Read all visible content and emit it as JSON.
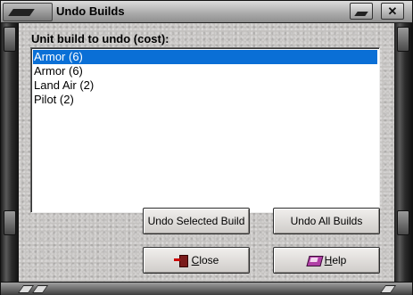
{
  "window": {
    "title": "Undo Builds",
    "close_glyph": "✕"
  },
  "prompt": "Unit build to undo (cost):",
  "list": {
    "items": [
      {
        "label": "Armor (6)",
        "selected": true
      },
      {
        "label": "Armor (6)",
        "selected": false
      },
      {
        "label": "Land Air (2)",
        "selected": false
      },
      {
        "label": "Pilot (2)",
        "selected": false
      }
    ]
  },
  "buttons": {
    "undo_selected": "Undo Selected Build",
    "undo_all": "Undo All Builds",
    "close_mnemonic": "C",
    "close_rest": "lose",
    "help_mnemonic": "H",
    "help_rest": "elp"
  },
  "colors": {
    "selection": "#0a6fd6",
    "panel": "#c4c2c0"
  },
  "icons": {
    "close": "exit-door-icon",
    "help": "help-book-icon"
  }
}
